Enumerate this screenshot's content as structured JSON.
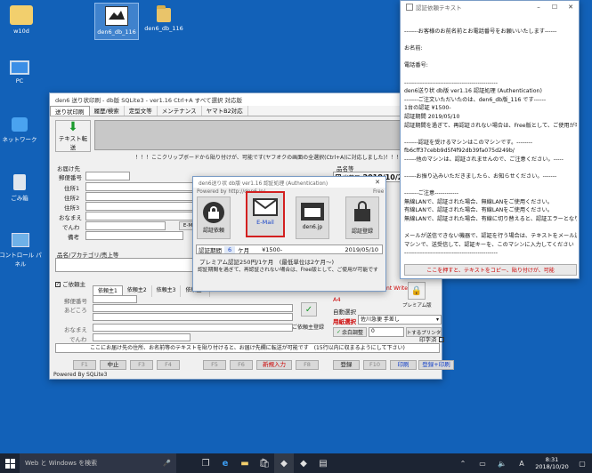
{
  "desktop": {
    "icons": [
      {
        "label": "w10d"
      },
      {
        "label": "den6_db_116"
      },
      {
        "label": "den6_db_116"
      },
      {
        "label": "PC"
      },
      {
        "label": "ネットワーク"
      },
      {
        "label": "ごみ箱"
      },
      {
        "label": "コントロール パネル"
      }
    ]
  },
  "main_window": {
    "title": "den6 送り状印刷 - db版 SQLite3 - ver1.16   Ctrl+A すべて選択   対応版",
    "tabs": [
      "送り状印刷",
      "履歴/検索",
      "定型文等",
      "メンテナンス",
      "ヤマトB2対応"
    ],
    "transfer_button": "テキスト転送",
    "clipboard_notice": "！！！ここクリップボードから貼り付けが、可能です(ヤフオクの画面の全選択(Ctrl+A)に対応しました)！！！",
    "ship_to_label": "お届け先",
    "postal_label": "郵便番号",
    "addr1_label": "住所1",
    "addr2_label": "住所2",
    "addr3_label": "住所3",
    "name_label": "おなまえ",
    "phone_label": "でんわ",
    "note_label": "備考",
    "item_label": "品名/プカテゴリ/売上等",
    "ship_date_label": "出荷日",
    "ship_date": "2018/10/20",
    "item_name_label": "品名等",
    "sender_label": "ご依頼主",
    "sender_tabs": [
      "依頼主1",
      "依頼主2",
      "依頼主3",
      "依頼主4"
    ],
    "sender_postal_label": "郵便番号",
    "sender_addr_label": "あどころ",
    "sender_name_label": "おなまえ",
    "sender_phone_label": "でんわ",
    "sender_register_label": "ご依頼主登録",
    "printer_writer": "nt Writer",
    "paper_size": "A4",
    "auto_select": "自動選択",
    "paper_type_label": "用紙選択",
    "paper_type_value": "佐川急便  手差し",
    "margin_button": "余白調整",
    "margin_value": "0",
    "set_printer_button": "セットするプリンタを登録",
    "print_label": "印字済",
    "premium_label": "プレミアム版",
    "bottom_notice": "ここにお届け先の住所、お名前等のテキストを貼り付けると、お届け先欄に転送が可能です　(15行以内に収まるようにして下さい)",
    "fkeys": [
      "F1",
      "中止",
      "F3",
      "F4",
      "F5",
      "F6",
      "新規入力",
      "F8",
      "登録",
      "F10",
      "印刷",
      "登録+印刷"
    ],
    "status_bar": "Powered By SQLite3"
  },
  "auth_dialog": {
    "title": "den6送り状 db版 ver1.16 認証処理 (Authentication)",
    "powered": "Powered by http://den6.jp/",
    "free_label": "Free",
    "features": [
      {
        "label": "認証依頼",
        "icon": "lock-icon"
      },
      {
        "label": "E-Mail",
        "icon": "mail-icon"
      },
      {
        "label": "den6.jp",
        "icon": "browser-icon"
      },
      {
        "label": "認証登録",
        "icon": "key-lock-icon"
      }
    ],
    "period_label": "認証期間",
    "period_value": "6",
    "period_unit": "ケ月",
    "price": "¥1500-",
    "expire_date": "2019/05/10",
    "premium_notice": "プレミアム認証250円/1ケ月　(最低単位は2ケ月〜)",
    "expire_notice": "認証期間を過ぎて、再認証されない場合は、Free版として、ご使用が可能です"
  },
  "notepad": {
    "title": "認証依頼テキスト",
    "lines": [
      "-------お客様のお前名前とお電話番号をお願いいたします------",
      "",
      "お名前:",
      "",
      "電話番号:",
      "",
      "-----------------------------------------------",
      "den6送り状 db版 ver1.16 認証処理 (Authentication)",
      "-------ご注文いただいたのは、den6_db版_116 です------",
      "1台の認証 ¥1500-",
      "認証期間  2019/05/10",
      "認証期間を過ぎて、再認証されない場合は、Free版として、ご使用が可能です",
      "",
      "-------認証を受けるマシンはこのマシンです。--------",
      "fb6cff37cebb9d5f4f92db39fa075d249b/",
      "------他のマシンは、認証されませんので、ご注意ください。-----",
      "",
      "------お振り込みいただきましたら、お知らせください。-------",
      "",
      "-------ご注意------------",
      "無線LANで、認証された場合、無線LANをご使用ください。",
      "有線LANで、認証された場合、有線LANをご使用ください。",
      "無線LANで、認証された場合、有線に切り替えると、認証エラーとなります",
      "",
      "メールが送信できない機器で、認証を行う場合は、テキストをメール送信可能な",
      "マシンで、送受信して、認証キーを、このマシンに入力してください",
      "-----------------------------------------------"
    ],
    "copy_button": "ここを押すと、テキストをコピー、貼り付けが、可能"
  },
  "taskbar": {
    "search_placeholder": "Web と Windows を検索",
    "time": "8:31",
    "date": "2018/10/20",
    "ime": "A"
  }
}
